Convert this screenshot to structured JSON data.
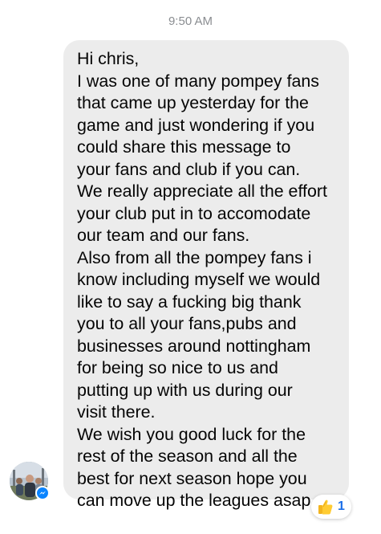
{
  "timestamp": "9:50 AM",
  "message": {
    "lines": [
      "Hi chris,",
      "I was one of many pompey fans",
      "that came up yesterday for the",
      "game and just wondering if you",
      "could share this message to",
      "your fans and club if you can.",
      "We really appreciate all the effort",
      "your club put in to accomodate",
      "our team and our fans.",
      "Also from all the pompey fans i",
      "know including myself we would",
      "like to say a fucking big thank",
      "you to all your fans,pubs and",
      "businesses around nottingham",
      "for being so nice to us and",
      "putting up with us during our",
      "visit there.",
      "We wish you good luck for the",
      "rest of the season and all the",
      "best for next season hope you",
      "can move up the leagues asap"
    ]
  },
  "reaction": {
    "icon": "thumbs-up-icon",
    "count": "1",
    "count_color": "#1c6fe8"
  },
  "sender": {
    "avatar_icon": "avatar",
    "badge_icon": "messenger-icon",
    "badge_color": "#0a84ff"
  },
  "colors": {
    "bubble": "#ececec",
    "text": "#050505",
    "timestamp": "#8a8d91"
  }
}
